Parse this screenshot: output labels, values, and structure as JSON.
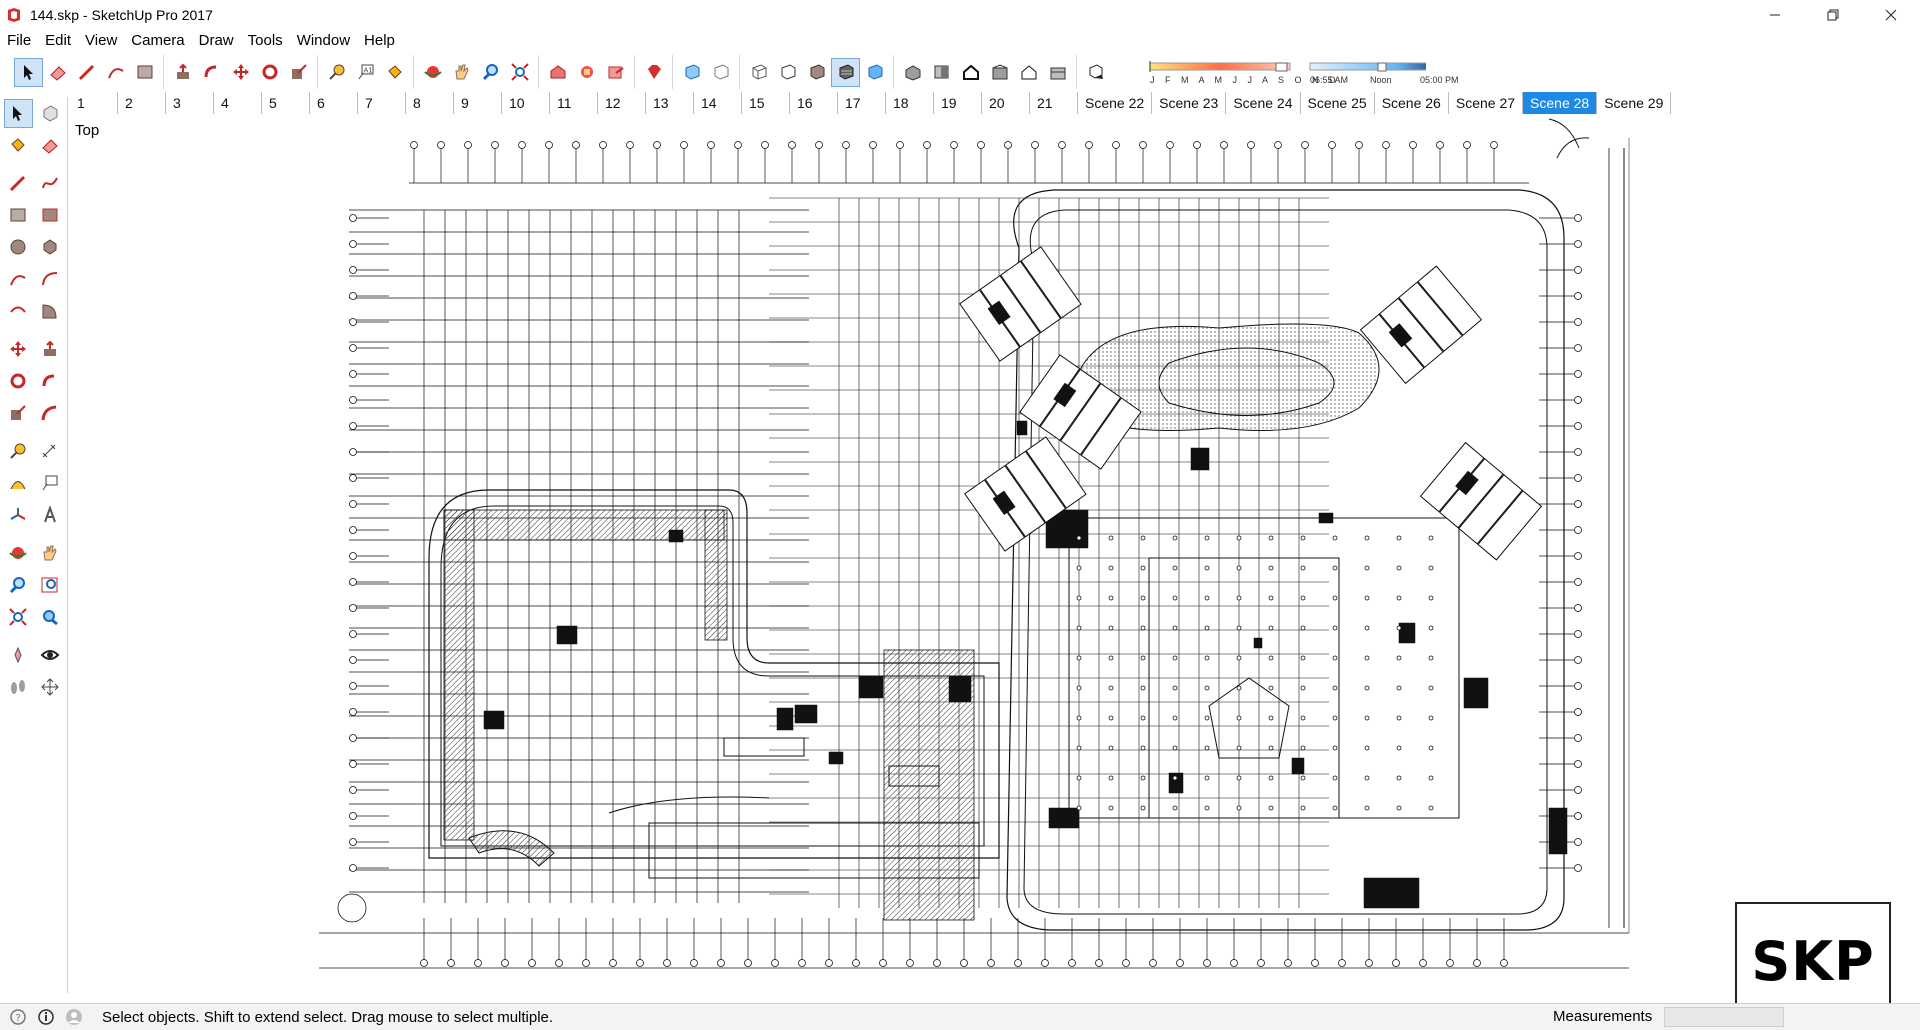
{
  "window": {
    "title": "144.skp - SketchUp Pro 2017",
    "minimize_icon": "minimize-icon",
    "maximize_icon": "restore-icon",
    "close_icon": "close-icon"
  },
  "menu": [
    "File",
    "Edit",
    "View",
    "Camera",
    "Draw",
    "Tools",
    "Window",
    "Help"
  ],
  "shadow_settings": {
    "months": "J F M A M J J A S O N D",
    "time_start": "06:55 AM",
    "time_mid": "Noon",
    "time_end": "05:00 PM"
  },
  "scenes": {
    "tabs": [
      "1",
      "2",
      "3",
      "4",
      "5",
      "6",
      "7",
      "8",
      "9",
      "10",
      "11",
      "12",
      "13",
      "14",
      "15",
      "16",
      "17",
      "18",
      "19",
      "20",
      "21",
      "Scene 22",
      "Scene 23",
      "Scene 24",
      "Scene 25",
      "Scene 26",
      "Scene 27",
      "Scene 28",
      "Scene 29"
    ],
    "active": "Scene 28"
  },
  "viewport": {
    "view_name": "Top"
  },
  "badge": {
    "text": "SKP"
  },
  "status": {
    "hint": "Select objects. Shift to extend select. Drag mouse to select multiple.",
    "measurements_label": "Measurements",
    "measurements_value": ""
  },
  "colors": {
    "accent": "#1e88e5",
    "toolbar_icon_red": "#c62828",
    "toolbar_icon_blue": "#1565c0"
  }
}
